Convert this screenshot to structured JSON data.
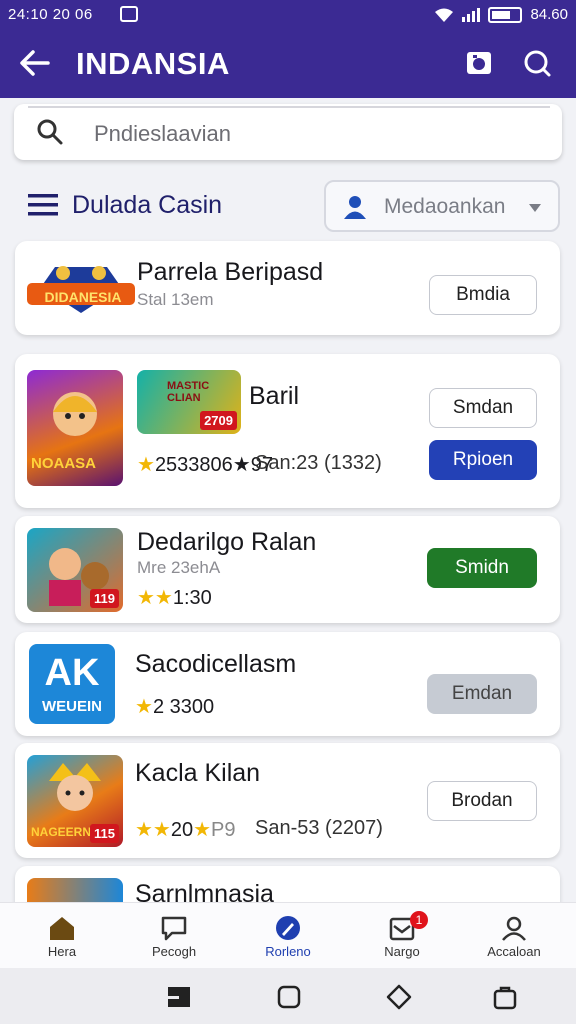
{
  "status_bar": {
    "time": "24:10 20 06",
    "battery": "84.60"
  },
  "app_bar": {
    "title": "INDANSIA"
  },
  "search": {
    "placeholder": "Pndieslaavian"
  },
  "filter": {
    "label": "Dulada Casin",
    "dropdown_value": "Medaoankan"
  },
  "apps": [
    {
      "name": "Parrela Beripasd",
      "subtitle": "Stal 13em",
      "button": "Bmdia",
      "logo_text": "DIDANESIA"
    },
    {
      "name": "Baril",
      "rating": "2533806★97",
      "reviews": "San:23 (1332)",
      "button_primary": "Smdan",
      "button_secondary": "Rpioen",
      "thumb_tag": "2709",
      "thumb_title": "NOAASA",
      "thumb2_title": "MASTIC CLIAN"
    },
    {
      "name": "Dedarilgo Ralan",
      "subtitle": "Mre 23ehA",
      "rating": "1:30",
      "button": "Smidn",
      "thumb_tag": "119"
    },
    {
      "name": "Sacodicellasm",
      "rating": "2 3300",
      "button": "Emdan",
      "logo_text": "AK",
      "logo_sub": "WEUEIN"
    },
    {
      "name": "Kacla Kilan",
      "rating": "20",
      "rating_extra": "P9",
      "reviews": "San-53 (2207)",
      "button": "Brodan",
      "thumb_tag": "115",
      "thumb_title": "NAGEERN"
    },
    {
      "name": "Sarnlmnasia"
    }
  ],
  "bottom_nav": [
    {
      "label": "Hera"
    },
    {
      "label": "Pecogh"
    },
    {
      "label": "Rorleno"
    },
    {
      "label": "Nargo",
      "badge": "1"
    },
    {
      "label": "Accaloan"
    }
  ],
  "colors": {
    "header": "#3b2a93",
    "accent_blue": "#2341b6",
    "accent_green": "#207a28",
    "star": "#f2b705"
  }
}
